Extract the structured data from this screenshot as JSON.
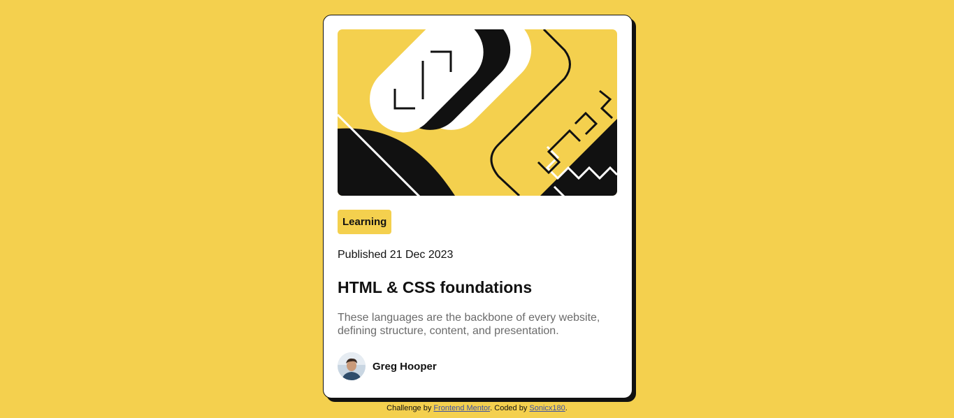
{
  "card": {
    "tag": "Learning",
    "published": "Published 21 Dec 2023",
    "title": "HTML & CSS foundations",
    "description": "These languages are the backbone of every website, defining structure, content, and presentation.",
    "author": "Greg Hooper"
  },
  "attribution": {
    "prefix": "Challenge by ",
    "link1": "Frontend Mentor",
    "middle": ". Coded by ",
    "link2": "Sonicx180",
    "suffix": "."
  },
  "colors": {
    "background": "#f4d04e",
    "card": "#ffffff",
    "ink": "#111111",
    "muted": "#6b6b6b"
  }
}
